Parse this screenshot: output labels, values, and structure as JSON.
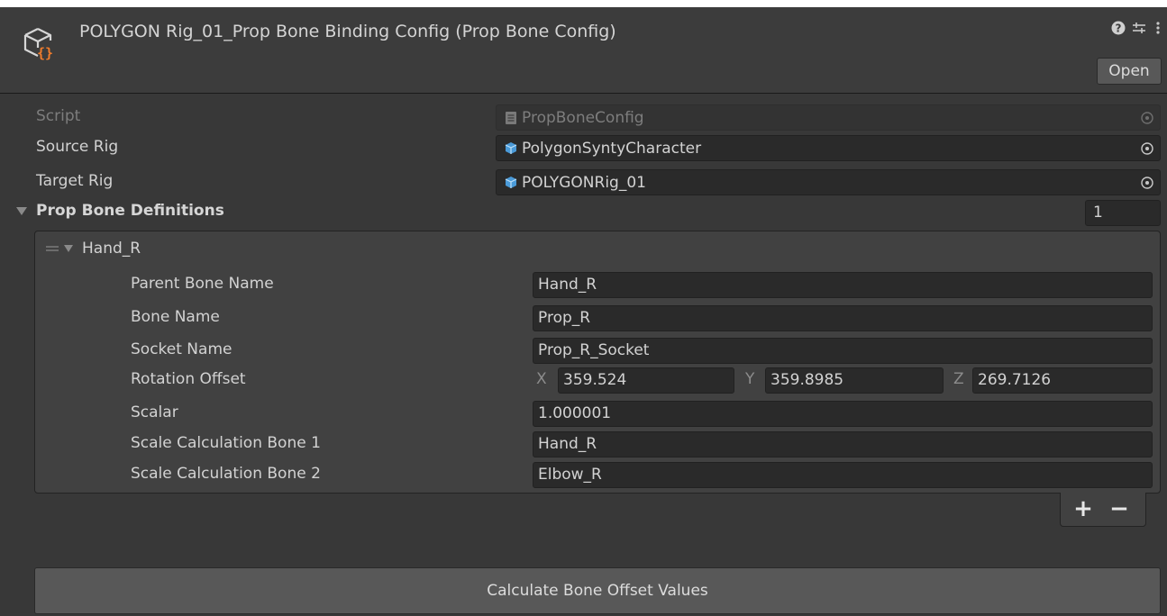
{
  "header": {
    "title": "POLYGON Rig_01_Prop Bone Binding Config (Prop Bone Config)",
    "icons": [
      "help-icon",
      "settings-sliders-icon",
      "kebab-menu-icon"
    ],
    "open_label": "Open"
  },
  "fields": {
    "script": {
      "label": "Script",
      "value": "PropBoneConfig"
    },
    "source_rig": {
      "label": "Source Rig",
      "value": "PolygonSyntyCharacter"
    },
    "target_rig": {
      "label": "Target Rig",
      "value": "POLYGONRig_01"
    }
  },
  "prop_bone_definitions": {
    "label": "Prop Bone Definitions",
    "count": "1",
    "element": {
      "title": "Hand_R",
      "parent_bone_name": {
        "label": "Parent Bone Name",
        "value": "Hand_R"
      },
      "bone_name": {
        "label": "Bone Name",
        "value": "Prop_R"
      },
      "socket_name": {
        "label": "Socket Name",
        "value": "Prop_R_Socket"
      },
      "rotation_offset": {
        "label": "Rotation Offset",
        "x_label": "X",
        "x": "359.524",
        "y_label": "Y",
        "y": "359.8985",
        "z_label": "Z",
        "z": "269.7126"
      },
      "scalar": {
        "label": "Scalar",
        "value": "1.000001"
      },
      "scale_bone_1": {
        "label": "Scale Calculation Bone 1",
        "value": "Hand_R"
      },
      "scale_bone_2": {
        "label": "Scale Calculation Bone 2",
        "value": "Elbow_R"
      }
    },
    "add_label": "+",
    "remove_label": "−"
  },
  "calculate_button": "Calculate Bone Offset Values",
  "colors": {
    "background": "#383838",
    "field": "#2a2a2a",
    "button": "#585858",
    "icon_blue": "#4a9ad8",
    "icon_orange": "#f07c2c"
  }
}
